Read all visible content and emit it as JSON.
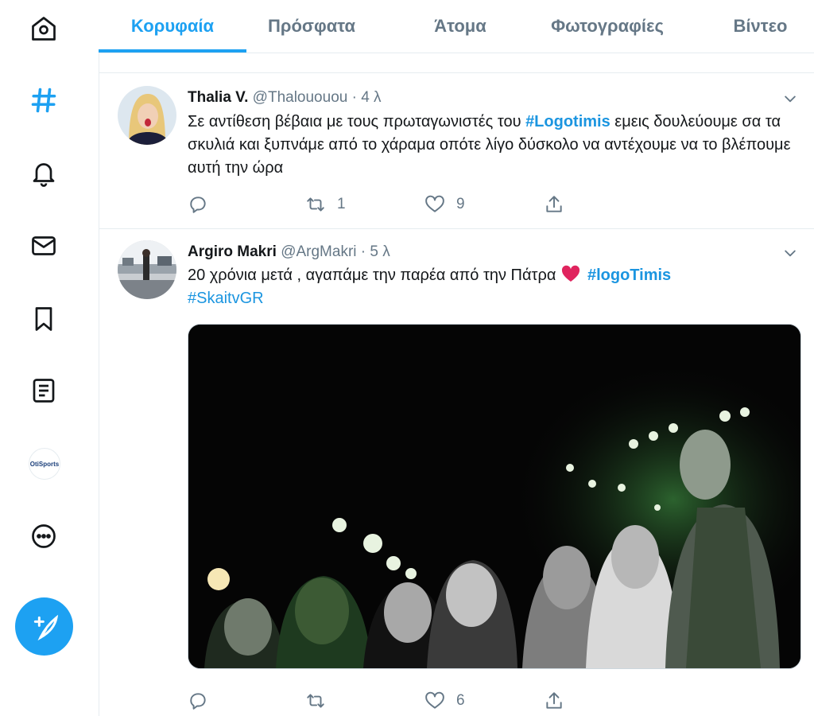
{
  "tabs": [
    {
      "label": "Κορυφαία",
      "active": true
    },
    {
      "label": "Πρόσφατα",
      "active": false
    },
    {
      "label": "Άτομα",
      "active": false
    },
    {
      "label": "Φωτογραφίες",
      "active": false
    },
    {
      "label": "Βίντεο",
      "active": false
    }
  ],
  "sidebar": {
    "icons": [
      "home-icon",
      "explore-hashtag-icon",
      "notifications-bell-icon",
      "messages-mail-icon",
      "bookmarks-icon",
      "lists-icon",
      "profile-avatar",
      "more-icon"
    ],
    "profile_logo_text": "OtiSports",
    "compose_icon": "compose-feather-icon"
  },
  "colors": {
    "accent": "#1da1f2",
    "hashtag": "#1b95e0",
    "like_red": "#e0245e"
  },
  "tweets": [
    {
      "name": "Thalia V.",
      "handle": "@Thalououou",
      "time": "· 4 λ",
      "text_parts": [
        "Σε αντίθεση βέβαια με τους πρωταγωνιστές του ",
        "#Logotimis",
        " εμεις δουλεύουμε σα τα σκυλιά και ξυπνάμε από το χάραμα οπότε λίγο δύσκολο να αντέχουμε να το βλέπουμε αυτή την ώρα"
      ],
      "replies": "",
      "retweets": "1",
      "likes": "9"
    },
    {
      "name": "Argiro Makri",
      "handle": "@ArgMakri",
      "time": "· 5 λ",
      "text_parts": [
        "20 χρόνια μετά , αγαπάμε την παρέα από την Πάτρα ",
        "#logoTimis",
        "#SkaitvGR"
      ],
      "replies": "",
      "retweets": "",
      "likes": "6"
    }
  ]
}
